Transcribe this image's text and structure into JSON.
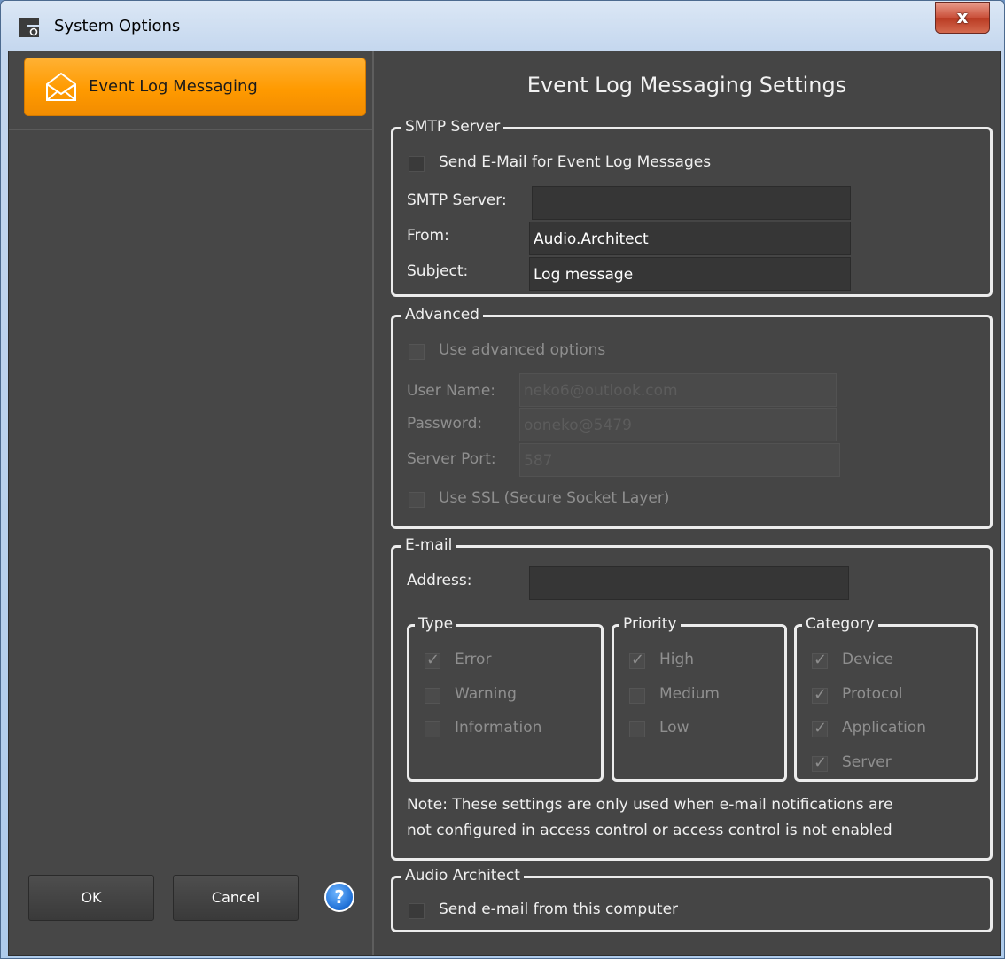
{
  "window": {
    "title": "System Options",
    "close_symbol": "x"
  },
  "sidebar": {
    "items": [
      {
        "label": "Event Log Messaging",
        "icon": "envelope-icon",
        "selected": true
      }
    ]
  },
  "footer": {
    "ok_label": "OK",
    "cancel_label": "Cancel",
    "help_symbol": "?"
  },
  "main": {
    "heading": "Event Log Messaging Settings",
    "smtp": {
      "legend": "SMTP Server",
      "send_email_label": "Send E-Mail for Event Log Messages",
      "send_email_checked": false,
      "server_label": "SMTP Server:",
      "server_value": "",
      "from_label": "From:",
      "from_value": "Audio.Architect",
      "subject_label": "Subject:",
      "subject_value": "Log message"
    },
    "advanced": {
      "legend": "Advanced",
      "use_advanced_label": "Use advanced options",
      "username_label": "User Name:",
      "username_value": "neko6@outlook.com",
      "password_label": "Password:",
      "password_value": "ooneko@5479",
      "port_label": "Server Port:",
      "port_value": "587",
      "ssl_label": "Use SSL (Secure Socket Layer)"
    },
    "email": {
      "legend": "E-mail",
      "address_label": "Address:",
      "address_value": "",
      "type": {
        "legend": "Type",
        "items": [
          {
            "label": "Error",
            "checked": true
          },
          {
            "label": "Warning",
            "checked": false
          },
          {
            "label": "Information",
            "checked": false
          }
        ]
      },
      "priority": {
        "legend": "Priority",
        "items": [
          {
            "label": "High",
            "checked": true
          },
          {
            "label": "Medium",
            "checked": false
          },
          {
            "label": "Low",
            "checked": false
          }
        ]
      },
      "category": {
        "legend": "Category",
        "items": [
          {
            "label": "Device",
            "checked": true
          },
          {
            "label": "Protocol",
            "checked": true
          },
          {
            "label": "Application",
            "checked": true
          },
          {
            "label": "Server",
            "checked": true
          }
        ]
      },
      "note_line1": "Note: These settings are only used when e-mail notifications are",
      "note_line2": "not configured in access control or access control is not enabled"
    },
    "audio_architect": {
      "legend": "Audio Architect",
      "send_from_computer_label": "Send e-mail from this computer",
      "checked": false
    }
  },
  "check_glyph": "✓"
}
